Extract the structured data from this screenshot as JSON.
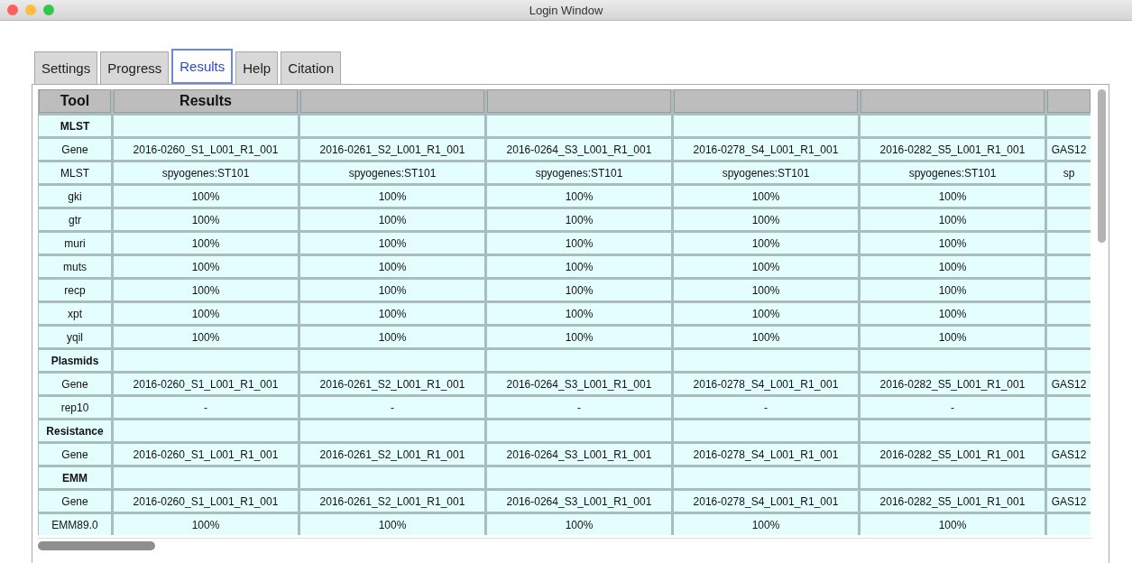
{
  "window": {
    "title": "Login Window"
  },
  "tabs": [
    {
      "label": "Settings",
      "selected": false
    },
    {
      "label": "Progress",
      "selected": false
    },
    {
      "label": "Results",
      "selected": true
    },
    {
      "label": "Help",
      "selected": false
    },
    {
      "label": "Citation",
      "selected": false
    }
  ],
  "table": {
    "columns": [
      "Tool",
      "Results"
    ],
    "rows": [
      {
        "kind": "section",
        "tool": "MLST"
      },
      {
        "kind": "data",
        "tool": "Gene",
        "cells": [
          "2016-0260_S1_L001_R1_001",
          "2016-0261_S2_L001_R1_001",
          "2016-0264_S3_L001_R1_001",
          "2016-0278_S4_L001_R1_001",
          "2016-0282_S5_L001_R1_001",
          "GAS12"
        ]
      },
      {
        "kind": "data",
        "tool": "MLST",
        "cells": [
          "spyogenes:ST101",
          "spyogenes:ST101",
          "spyogenes:ST101",
          "spyogenes:ST101",
          "spyogenes:ST101",
          "sp"
        ]
      },
      {
        "kind": "data",
        "tool": "gki",
        "cells": [
          "100%",
          "100%",
          "100%",
          "100%",
          "100%"
        ]
      },
      {
        "kind": "data",
        "tool": "gtr",
        "cells": [
          "100%",
          "100%",
          "100%",
          "100%",
          "100%"
        ]
      },
      {
        "kind": "data",
        "tool": "muri",
        "cells": [
          "100%",
          "100%",
          "100%",
          "100%",
          "100%"
        ]
      },
      {
        "kind": "data",
        "tool": "muts",
        "cells": [
          "100%",
          "100%",
          "100%",
          "100%",
          "100%"
        ]
      },
      {
        "kind": "data",
        "tool": "recp",
        "cells": [
          "100%",
          "100%",
          "100%",
          "100%",
          "100%"
        ]
      },
      {
        "kind": "data",
        "tool": "xpt",
        "cells": [
          "100%",
          "100%",
          "100%",
          "100%",
          "100%"
        ]
      },
      {
        "kind": "data",
        "tool": "yqil",
        "cells": [
          "100%",
          "100%",
          "100%",
          "100%",
          "100%"
        ]
      },
      {
        "kind": "section",
        "tool": "Plasmids"
      },
      {
        "kind": "data",
        "tool": "Gene",
        "cells": [
          "2016-0260_S1_L001_R1_001",
          "2016-0261_S2_L001_R1_001",
          "2016-0264_S3_L001_R1_001",
          "2016-0278_S4_L001_R1_001",
          "2016-0282_S5_L001_R1_001",
          "GAS12"
        ]
      },
      {
        "kind": "data",
        "tool": "rep10",
        "cells": [
          "-",
          "-",
          "-",
          "-",
          "-"
        ]
      },
      {
        "kind": "section",
        "tool": "Resistance"
      },
      {
        "kind": "data",
        "tool": "Gene",
        "cells": [
          "2016-0260_S1_L001_R1_001",
          "2016-0261_S2_L001_R1_001",
          "2016-0264_S3_L001_R1_001",
          "2016-0278_S4_L001_R1_001",
          "2016-0282_S5_L001_R1_001",
          "GAS12"
        ]
      },
      {
        "kind": "section",
        "tool": "EMM"
      },
      {
        "kind": "data",
        "tool": "Gene",
        "cells": [
          "2016-0260_S1_L001_R1_001",
          "2016-0261_S2_L001_R1_001",
          "2016-0264_S3_L001_R1_001",
          "2016-0278_S4_L001_R1_001",
          "2016-0282_S5_L001_R1_001",
          "GAS12"
        ]
      },
      {
        "kind": "data",
        "tool": "EMM89.0",
        "cells": [
          "100%",
          "100%",
          "100%",
          "100%",
          "100%"
        ]
      }
    ]
  }
}
